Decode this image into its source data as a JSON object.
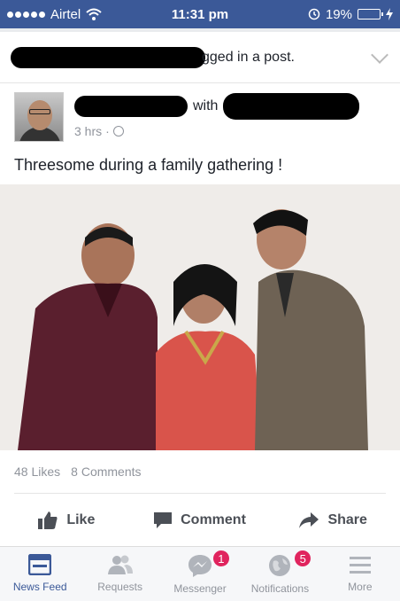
{
  "status_bar": {
    "carrier": "Airtel",
    "time": "11:31 pm",
    "battery": "19%",
    "battery_level": 0.19
  },
  "story": {
    "text": "gged in a post."
  },
  "post": {
    "with_text": "with",
    "time": "3 hrs",
    "separator": "·",
    "text": "Threesome during a family gathering !"
  },
  "stats": {
    "likes": "48 Likes",
    "comments": "8 Comments"
  },
  "actions": {
    "like": "Like",
    "comment": "Comment",
    "share": "Share"
  },
  "nav": {
    "items": [
      {
        "label": "News Feed"
      },
      {
        "label": "Requests"
      },
      {
        "label": "Messenger",
        "badge": "1"
      },
      {
        "label": "Notifications",
        "badge": "5"
      },
      {
        "label": "More"
      }
    ]
  },
  "colors": {
    "brand": "#3b5998",
    "badge": "#e0245e",
    "muted": "#90949c"
  }
}
